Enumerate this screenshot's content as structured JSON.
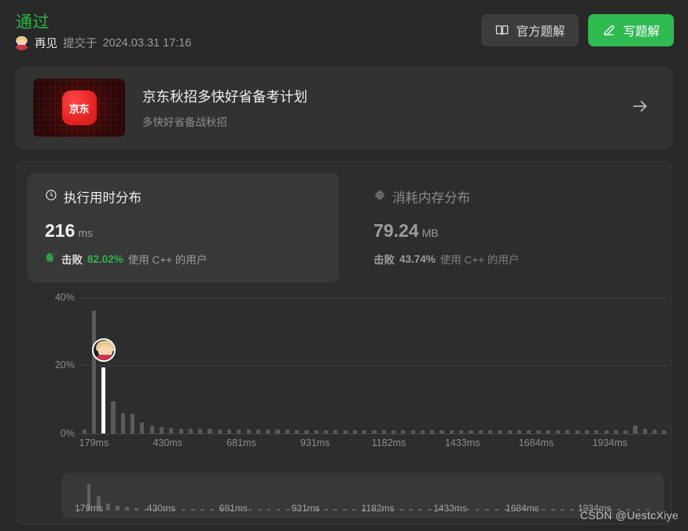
{
  "header": {
    "verdict": "通过",
    "user": "再见",
    "submitted_prefix": "提交于",
    "submitted_time": "2024.03.31 17:16",
    "avatar_icon": "user-avatar-icon",
    "buttons": [
      {
        "label": "官方题解",
        "icon": "book-icon",
        "style": "ghost"
      },
      {
        "label": "写题解",
        "icon": "pencil-edit-icon",
        "style": "primary"
      }
    ]
  },
  "promo": {
    "logo_text": "京东",
    "title": "京东秋招多快好省备考计划",
    "subtitle": "多快好省备战秋招",
    "arrow_icon": "arrow-right-icon"
  },
  "stats": {
    "runtime": {
      "icon": "clock-icon",
      "title": "执行用时分布",
      "value": "216",
      "unit": "ms",
      "beat_icon": "clapping-hands-icon",
      "beat_label": "击败",
      "beat_pct": "82.02%",
      "beat_suffix": "使用 C++ 的用户",
      "active": true
    },
    "memory": {
      "icon": "chip-icon",
      "title": "消耗内存分布",
      "value": "79.24",
      "unit": "MB",
      "beat_label": "击败",
      "beat_pct": "43.74%",
      "beat_suffix": "使用 C++ 的用户",
      "active": false
    }
  },
  "chart_data": {
    "type": "bar",
    "title": "执行用时分布",
    "xlabel": "",
    "ylabel": "",
    "ylim": [
      0,
      45
    ],
    "ytick_labels": [
      "0%",
      "20%",
      "40%"
    ],
    "ytick_values": [
      0,
      20,
      40
    ],
    "xtick_labels": [
      "179ms",
      "430ms",
      "681ms",
      "931ms",
      "1182ms",
      "1433ms",
      "1684ms",
      "1934ms"
    ],
    "xtick_values": [
      179,
      430,
      681,
      931,
      1182,
      1433,
      1684,
      1934
    ],
    "grid": true,
    "legend": false,
    "highlight_index": 2,
    "highlight_label": "216ms",
    "highlight_value": 19.5,
    "marker_icon": "user-avatar-marker",
    "values": [
      1.2,
      36.0,
      19.5,
      9.5,
      6.0,
      5.8,
      3.2,
      2.4,
      1.9,
      1.7,
      1.5,
      1.4,
      1.3,
      1.3,
      1.2,
      1.2,
      1.2,
      1.1,
      1.1,
      1.1,
      1.1,
      1.1,
      1.0,
      1.0,
      1.0,
      1.0,
      1.0,
      1.0,
      1.0,
      1.0,
      1.0,
      1.0,
      1.0,
      1.0,
      1.0,
      1.0,
      1.0,
      1.0,
      1.0,
      1.0,
      1.0,
      1.0,
      1.0,
      1.0,
      1.0,
      1.0,
      1.0,
      1.0,
      1.0,
      1.0,
      1.0,
      1.0,
      1.0,
      1.0,
      1.0,
      1.0,
      1.0,
      2.4,
      1.3,
      1.2,
      1.0
    ]
  },
  "brush": {
    "xtick_labels": [
      "179ms",
      "430ms",
      "681ms",
      "931ms",
      "1182ms",
      "1433ms",
      "1684ms",
      "1934ms"
    ]
  },
  "watermark": "CSDN @UestcXiye",
  "colors": {
    "accent_green": "#2fba52",
    "verdict_green": "#2bb44a",
    "bar_gray": "#5a5a5a",
    "bar_highlight": "#ffffff",
    "panel_bg": "#2d2d2d",
    "page_bg": "#282828"
  }
}
